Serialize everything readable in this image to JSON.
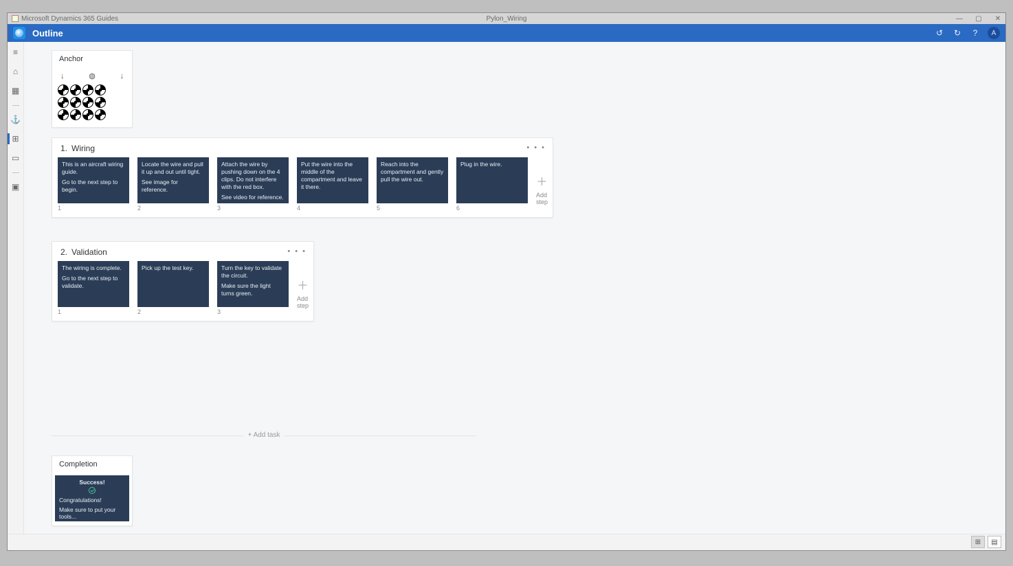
{
  "titlebar": {
    "app": "Microsoft Dynamics 365 Guides",
    "document": "Pylon_Wiring",
    "min": "—",
    "max": "▢",
    "close": "✕"
  },
  "commandbar": {
    "section": "Outline",
    "undo": "↺",
    "redo": "↻",
    "help": "?",
    "user_initial": "A"
  },
  "leftrail": {
    "menu": "≡",
    "home": "⌂",
    "image": "▦",
    "anchor": "⚓",
    "outline": "⊞",
    "step": "▭",
    "box": "▣",
    "info": "ⓘ"
  },
  "anchor": {
    "title": "Anchor"
  },
  "tasks": [
    {
      "number": "1.",
      "title": "Wiring",
      "steps": [
        {
          "num": "1",
          "lines": [
            "This is an aircraft wiring guide.",
            "Go to the next step to begin."
          ]
        },
        {
          "num": "2",
          "lines": [
            "Locate the wire and pull it up and out until tight.",
            "See image for reference."
          ]
        },
        {
          "num": "3",
          "lines": [
            "Attach the wire by pushing down on the 4 clips.  Do not interfere with the red box.",
            "See video for reference."
          ]
        },
        {
          "num": "4",
          "lines": [
            "Put the wire into the middle of the compartment and leave it there."
          ]
        },
        {
          "num": "5",
          "lines": [
            "Reach into the compartment and gently pull the wire out."
          ]
        },
        {
          "num": "6",
          "lines": [
            "Plug in the wire."
          ]
        }
      ],
      "addstep": "Add step"
    },
    {
      "number": "2.",
      "title": "Validation",
      "steps": [
        {
          "num": "1",
          "lines": [
            "The wiring is complete.",
            "Go to the next step to validate."
          ]
        },
        {
          "num": "2",
          "lines": [
            "Pick up the test key."
          ]
        },
        {
          "num": "3",
          "lines": [
            "Turn the key to validate the circuit.",
            "Make sure the light turns green."
          ]
        }
      ],
      "addstep": "Add step"
    }
  ],
  "addtask": "+  Add task",
  "completion": {
    "title": "Completion",
    "success": "Success!",
    "line1": "Congratulations!",
    "line2": "Make sure to put your tools..."
  },
  "views": {
    "grid": "⊞",
    "detail": "▤"
  }
}
